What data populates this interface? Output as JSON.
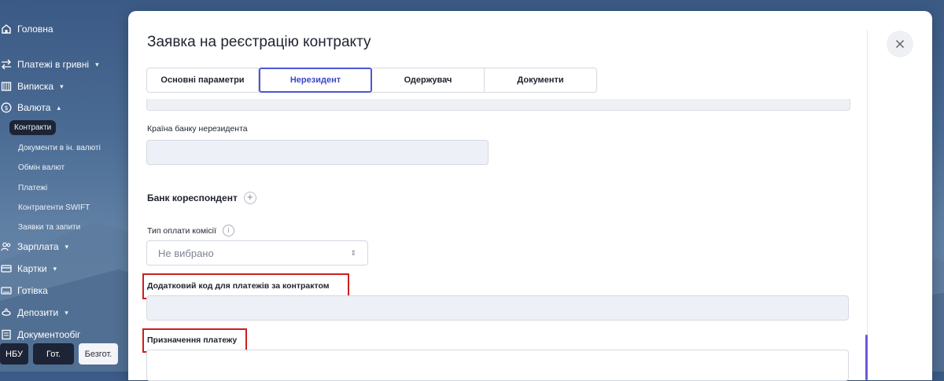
{
  "sidebar": {
    "items": [
      {
        "label": "Головна",
        "icon": "home-icon",
        "caret": ""
      },
      {
        "label": "Платежі в гривні",
        "icon": "transfer-icon",
        "caret": "▾"
      },
      {
        "label": "Виписка",
        "icon": "statement-icon",
        "caret": "▾"
      },
      {
        "label": "Валюта",
        "icon": "currency-icon",
        "caret": "▴"
      },
      {
        "label": "Зарплата",
        "icon": "people-icon",
        "caret": "▾"
      },
      {
        "label": "Картки",
        "icon": "card-icon",
        "caret": "▾"
      },
      {
        "label": "Готівка",
        "icon": "cash-icon",
        "caret": ""
      },
      {
        "label": "Депозити",
        "icon": "deposit-icon",
        "caret": "▾"
      },
      {
        "label": "Документообіг",
        "icon": "document-icon",
        "caret": ""
      }
    ],
    "currency_sub": [
      {
        "label": "Контракти",
        "active": true
      },
      {
        "label": "Документи в ін. валюті"
      },
      {
        "label": "Обмін валют"
      },
      {
        "label": "Платежі"
      },
      {
        "label": "Контрагенти SWIFT"
      },
      {
        "label": "Заявки та запити"
      }
    ],
    "bottom_buttons": [
      "НБУ",
      "Гот.",
      "Безгот."
    ]
  },
  "modal": {
    "title": "Заявка на реєстрацію контракту",
    "tabs": [
      "Основні параметри",
      "Нерезидент",
      "Одержувач",
      "Документи"
    ],
    "active_tab": "Нерезидент",
    "bank_country_label": "Країна банку нерезидента",
    "bank_country_value": "",
    "correspondent_title": "Банк кореспондент",
    "fee_type_label": "Тип оплати комісії",
    "fee_type_value": "Не вибрано",
    "extra_code_label": "Додатковий код для платежів за контрактом",
    "extra_code_value": "",
    "purpose_label": "Призначення платежу",
    "purpose_value": ""
  },
  "colors": {
    "accent": "#4a57d6",
    "highlight": "#cc1f1f",
    "sidebar_active": "#1c2436"
  }
}
